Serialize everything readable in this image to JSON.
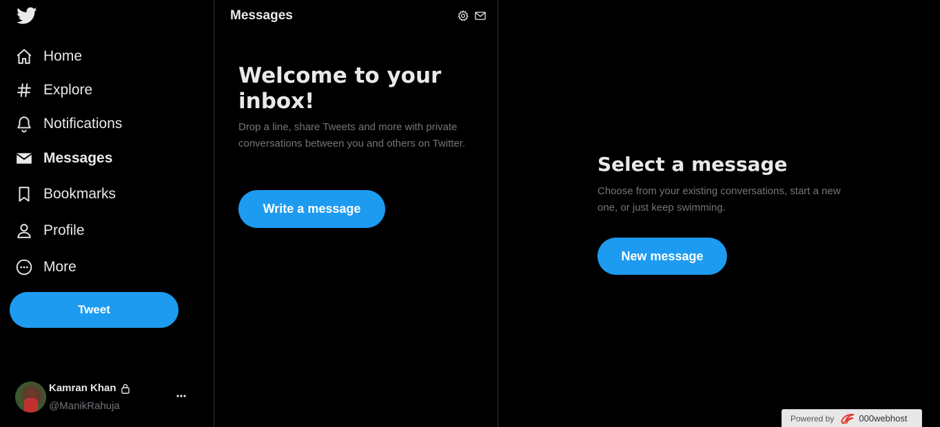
{
  "sidebar": {
    "logo_icon": "twitter-bird-icon",
    "items": [
      {
        "label": "Home",
        "icon": "home-icon"
      },
      {
        "label": "Explore",
        "icon": "hashtag-icon"
      },
      {
        "label": "Notifications",
        "icon": "bell-icon"
      },
      {
        "label": "Messages",
        "icon": "envelope-icon",
        "active": true
      },
      {
        "label": "Bookmarks",
        "icon": "bookmark-icon"
      },
      {
        "label": "Profile",
        "icon": "person-icon"
      },
      {
        "label": "More",
        "icon": "more-circle-icon"
      }
    ],
    "tweet_label": "Tweet",
    "account": {
      "name": "Kamran Khan",
      "handle": "@ManikRahuja",
      "locked": true
    }
  },
  "messages": {
    "title": "Messages",
    "welcome_title": "Welcome to your inbox!",
    "welcome_desc": "Drop a line, share Tweets and more with private conversations between you and others on Twitter.",
    "write_label": "Write a message"
  },
  "detail": {
    "title": "Select a message",
    "desc": "Choose from your existing conversations, start a new one, or just keep swimming.",
    "new_label": "New message"
  },
  "powered": {
    "by": "Powered by",
    "host": "000webhost"
  },
  "colors": {
    "accent": "#1d9bf0",
    "background": "#000000",
    "muted_text": "#71767b"
  }
}
